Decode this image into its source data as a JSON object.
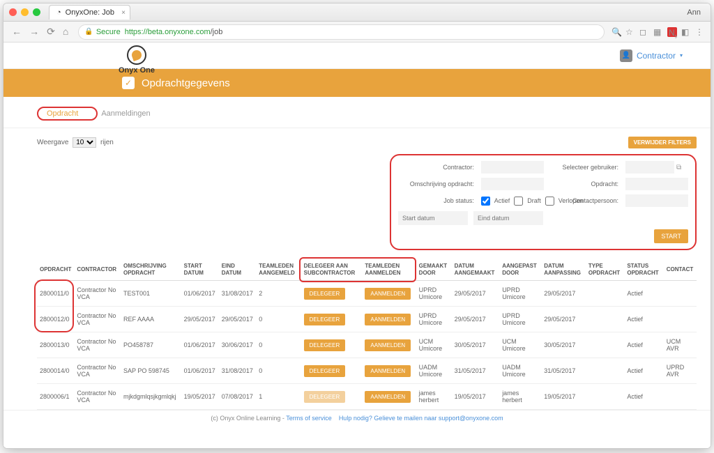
{
  "browser": {
    "tab_title": "OnyxOne: Job",
    "profile": "Ann",
    "secure_label": "Secure",
    "url_host": "https://beta.onyxone.com",
    "url_path": "/job"
  },
  "logo": {
    "line1": "Onyx One"
  },
  "user_menu": {
    "label": "Contractor"
  },
  "banner": {
    "title": "Opdrachtgegevens"
  },
  "tabs": {
    "active": "Opdracht",
    "other": "Aanmeldingen"
  },
  "table_controls": {
    "weergave_label": "Weergave",
    "rows": "10",
    "rijen": "rijen",
    "clear_filters": "VERWIJDER FILTERS"
  },
  "filters": {
    "contractor": "Contractor:",
    "selecteer": "Selecteer gebruiker:",
    "omschrijving": "Omschrijving opdracht:",
    "opdracht": "Opdracht:",
    "jobstatus": "Job status:",
    "contactpersoon": "Contactpersoon:",
    "actief": "Actief",
    "draft": "Draft",
    "verlopen": "Verlopen",
    "start_ph": "Start datum",
    "eind_ph": "Eind datum",
    "start_btn": "START"
  },
  "columns": [
    "OPDRACHT",
    "CONTRACTOR",
    "OMSCHRIJVING OPDRACHT",
    "START DATUM",
    "EIND DATUM",
    "TEAMLEDEN AANGEMELD",
    "DELEGEER AAN SUBCONTRACTOR",
    "TEAMLEDEN AANMELDEN",
    "GEMAAKT DOOR",
    "DATUM AANGEMAAKT",
    "AANGEPAST DOOR",
    "DATUM AANPASSING",
    "TYPE OPDRACHT",
    "STATUS OPDRACHT",
    "CONTACT"
  ],
  "buttons": {
    "delegeer": "DELEGEER",
    "aanmelden": "AANMELDEN"
  },
  "rows": [
    {
      "opdracht": "2800011/0",
      "contractor": "Contractor No VCA",
      "omschrijving": "TEST001",
      "start": "01/06/2017",
      "eind": "31/08/2017",
      "team": "2",
      "gemaakt": "UPRD Umicore",
      "datum_g": "29/05/2017",
      "aangepast": "UPRD Umicore",
      "datum_a": "29/05/2017",
      "type": "",
      "status": "Actief",
      "contact": "",
      "circled": true,
      "delegeer_disabled": false
    },
    {
      "opdracht": "2800012/0",
      "contractor": "Contractor No VCA",
      "omschrijving": "REF AAAA",
      "start": "29/05/2017",
      "eind": "29/05/2017",
      "team": "0",
      "gemaakt": "UPRD Umicore",
      "datum_g": "29/05/2017",
      "aangepast": "UPRD Umicore",
      "datum_a": "29/05/2017",
      "type": "",
      "status": "Actief",
      "contact": "",
      "circled": true,
      "delegeer_disabled": false
    },
    {
      "opdracht": "2800013/0",
      "contractor": "Contractor No VCA",
      "omschrijving": "PO458787",
      "start": "01/06/2017",
      "eind": "30/06/2017",
      "team": "0",
      "gemaakt": "UCM Umicore",
      "datum_g": "30/05/2017",
      "aangepast": "UCM Umicore",
      "datum_a": "30/05/2017",
      "type": "",
      "status": "Actief",
      "contact": "UCM AVR",
      "circled": false,
      "delegeer_disabled": false
    },
    {
      "opdracht": "2800014/0",
      "contractor": "Contractor No VCA",
      "omschrijving": "SAP PO 598745",
      "start": "01/06/2017",
      "eind": "31/08/2017",
      "team": "0",
      "gemaakt": "UADM Umicore",
      "datum_g": "31/05/2017",
      "aangepast": "UADM Umicore",
      "datum_a": "31/05/2017",
      "type": "",
      "status": "Actief",
      "contact": "UPRD AVR",
      "circled": false,
      "delegeer_disabled": false
    },
    {
      "opdracht": "2800006/1",
      "contractor": "Contractor No VCA",
      "omschrijving": "mjkdgmlqsjkgmlqkj",
      "start": "19/05/2017",
      "eind": "07/08/2017",
      "team": "1",
      "gemaakt": "james herbert",
      "datum_g": "19/05/2017",
      "aangepast": "james herbert",
      "datum_a": "19/05/2017",
      "type": "",
      "status": "Actief",
      "contact": "",
      "circled": false,
      "delegeer_disabled": true
    }
  ],
  "footer": {
    "prefix": "(c) Onyx Online Learning - ",
    "tos": "Terms of service",
    "help": "Hulp nodig? Gelieve te mailen naar support@onyxone.com"
  }
}
